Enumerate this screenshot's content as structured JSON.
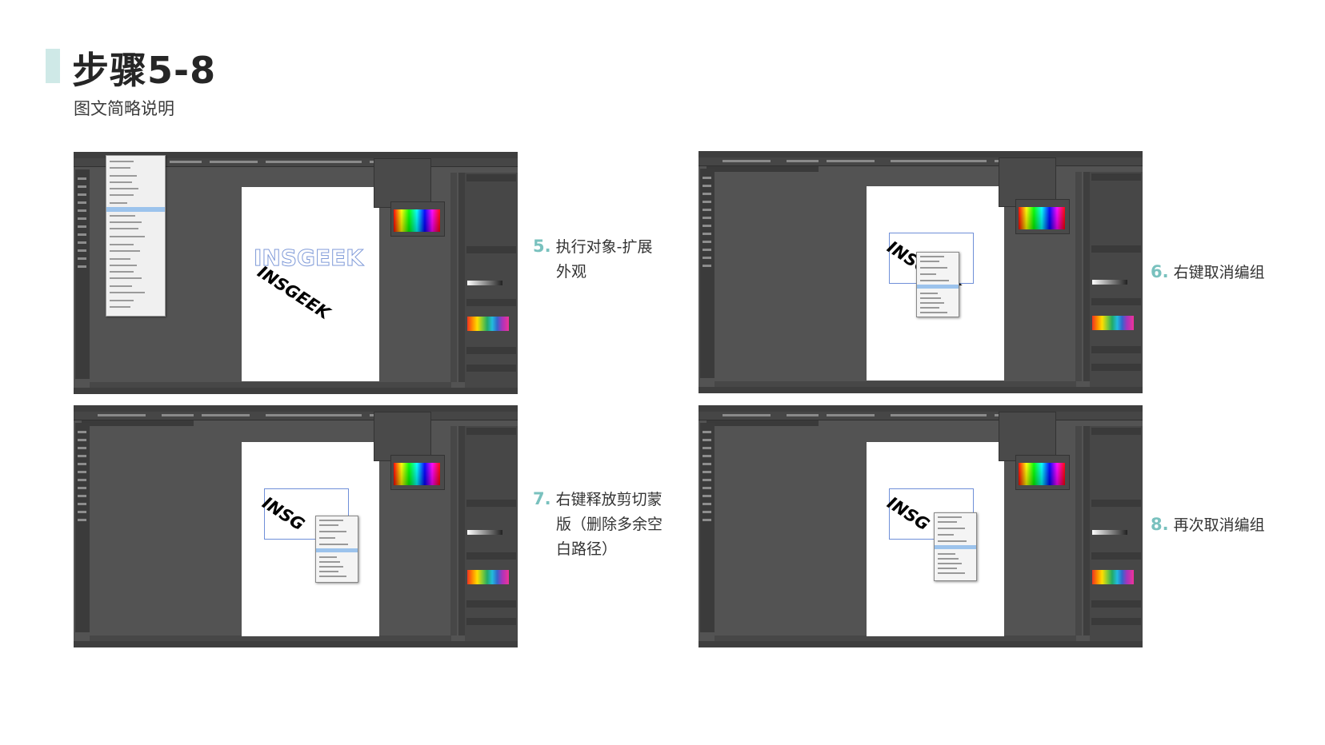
{
  "header": {
    "title": "步骤5-8",
    "subtitle": "图文简略说明"
  },
  "steps": [
    {
      "number": "5.",
      "line1": "执行对象-扩展",
      "line2": "外观"
    },
    {
      "number": "6.",
      "line1": "右键取消编组"
    },
    {
      "number": "7.",
      "line1": "右键释放剪切蒙",
      "line2": "版（删除多余空",
      "line3": "白路径）"
    },
    {
      "number": "8.",
      "line1": "再次取消编组"
    }
  ],
  "artwork": {
    "text": "INSGEEK",
    "text_partial": "INSG"
  },
  "colors": {
    "accent_bar": "#cfe9e7",
    "step_number": "#79c1be",
    "app_background": "#535353",
    "selection": "#6f8fd8",
    "menu_highlight": "#9cc3ec"
  }
}
